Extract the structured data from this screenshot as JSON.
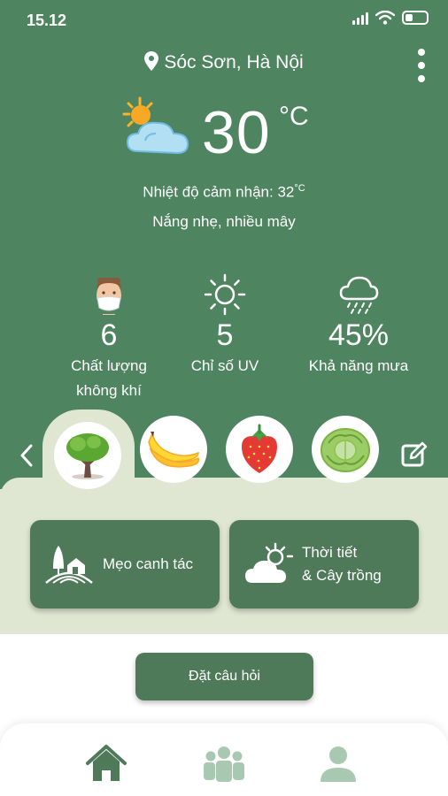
{
  "status_bar": {
    "time": "15.12"
  },
  "location": {
    "name": "Sóc Sơn, Hà Nội"
  },
  "weather": {
    "temperature": "30",
    "unit": "°C",
    "feels_like_label": "Nhiệt độ cảm nhận: 32",
    "feels_like_unit": "°C",
    "description": "Nắng nhẹ, nhiều mây"
  },
  "metrics": [
    {
      "icon": "face-mask-icon",
      "value": "6",
      "label_line1": "Chất lượng",
      "label_line2": "không khí"
    },
    {
      "icon": "sun-icon",
      "value": "5",
      "label_line1": "Chỉ số UV",
      "label_line2": ""
    },
    {
      "icon": "rain-cloud-icon",
      "value": "45%",
      "label_line1": "Khả năng mưa",
      "label_line2": ""
    }
  ],
  "crops": [
    {
      "icon": "tree-icon",
      "selected": true
    },
    {
      "icon": "banana-icon",
      "selected": false
    },
    {
      "icon": "strawberry-icon",
      "selected": false
    },
    {
      "icon": "cabbage-icon",
      "selected": false
    }
  ],
  "cards": {
    "tips_label": "Mẹo canh tác",
    "weather_crop_line1": "Thời tiết",
    "weather_crop_line2": "& Cây trồng"
  },
  "ask_button": {
    "label": "Đặt câu hỏi"
  },
  "bottom_nav": [
    {
      "icon": "home-icon",
      "active": true
    },
    {
      "icon": "community-icon",
      "active": false
    },
    {
      "icon": "profile-icon",
      "active": false
    }
  ],
  "colors": {
    "primary": "#4f8461",
    "card": "#4f7a5a",
    "light": "#dfe6d2",
    "inactive": "#a8c8b2"
  }
}
